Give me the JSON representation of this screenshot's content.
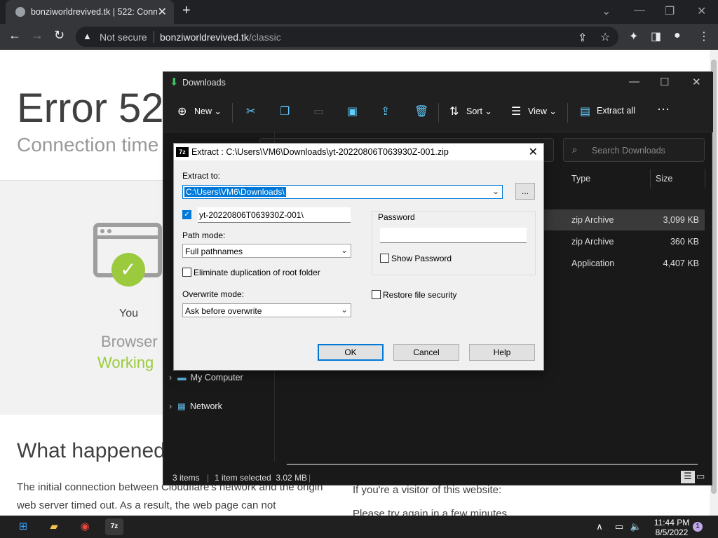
{
  "browser": {
    "tab_title": "bonziworldrevived.tk | 522: Conn",
    "security_label": "Not secure",
    "url_host": "bonziworldrevived.tk",
    "url_path": "/classic"
  },
  "page": {
    "error_heading": "Error 522",
    "error_subtitle": "Connection time",
    "you_label": "You",
    "browser_label": "Browser",
    "working_label": "Working",
    "what_heading": "What happened",
    "para1": "The initial connection between Cloudflare's network and the origin web server timed out. As a result, the web page can not",
    "para2_line1": "If you're a visitor of this website:",
    "para2_line2": "Please try again in a few minutes."
  },
  "explorer": {
    "title": "Downloads",
    "commands": {
      "new": "New",
      "sort": "Sort",
      "view": "View",
      "extract_all": "Extract all"
    },
    "search_placeholder": "Search Downloads",
    "columns": {
      "type": "Type",
      "size": "Size"
    },
    "files": [
      {
        "type": "zip Archive",
        "size": "3,099 KB"
      },
      {
        "type": "zip Archive",
        "size": "360 KB"
      },
      {
        "type": "Application",
        "size": "4,407 KB"
      }
    ],
    "nav": {
      "my_computer": "My Computer",
      "network": "Network"
    },
    "status": {
      "items": "3 items",
      "selected": "1 item selected  3.02 MB"
    }
  },
  "dialog": {
    "title": "Extract : C:\\Users\\VM6\\Downloads\\yt-20220806T063930Z-001.zip",
    "extract_to_label": "Extract to:",
    "extract_to_value": "C:\\Users\\VM6\\Downloads\\",
    "browse_label": "...",
    "subfolder_value": "yt-20220806T063930Z-001\\",
    "path_mode_label": "Path mode:",
    "path_mode_value": "Full pathnames",
    "eliminate_label": "Eliminate duplication of root folder",
    "overwrite_label": "Overwrite mode:",
    "overwrite_value": "Ask before overwrite",
    "password_label": "Password",
    "show_password_label": "Show Password",
    "restore_security_label": "Restore file security",
    "ok": "OK",
    "cancel": "Cancel",
    "help": "Help"
  },
  "taskbar": {
    "time": "11:44 PM",
    "date": "8/5/2022",
    "notification_count": "1"
  }
}
